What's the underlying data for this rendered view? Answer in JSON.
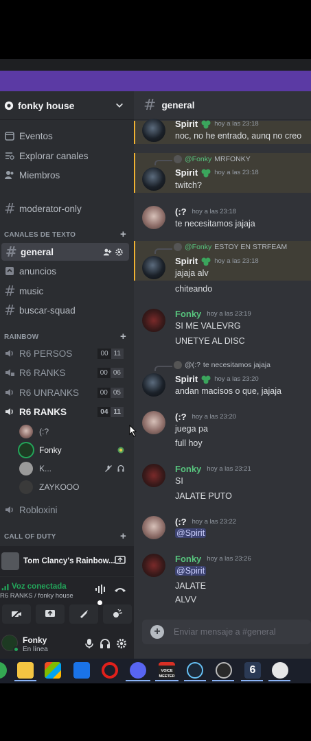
{
  "server": {
    "name": "fonky house"
  },
  "nav": [
    {
      "label": "Eventos",
      "icon": "calendar-icon"
    },
    {
      "label": "Explorar canales",
      "icon": "browse-channels-icon"
    },
    {
      "label": "Miembros",
      "icon": "members-icon"
    }
  ],
  "channels_top": [
    {
      "label": "moderator-only"
    }
  ],
  "categories": {
    "text": "CANALES DE TEXTO",
    "rainbow": "RAINBOW",
    "cod": "CALL OF DUTY"
  },
  "text_channels": [
    {
      "label": "general",
      "active": true
    },
    {
      "label": "anuncios",
      "icon": "announcement-icon"
    },
    {
      "label": "music"
    },
    {
      "label": "buscar-squad"
    }
  ],
  "voice_channels": [
    {
      "label": "R6 PERSOS",
      "a": "00",
      "b": "11"
    },
    {
      "label": "R6 RANKS",
      "a": "00",
      "b": "06"
    },
    {
      "label": "R6 UNRANKS",
      "a": "00",
      "b": "05"
    },
    {
      "label": "R6 RANKS",
      "a": "04",
      "b": "11",
      "bold": true
    }
  ],
  "voice_members": [
    {
      "name": "(:?"
    },
    {
      "name": "Fonky",
      "speaking": true
    },
    {
      "name": "K..."
    },
    {
      "name": "ZAYKOOO"
    }
  ],
  "voice_channels_2": [
    {
      "label": "Robloxini"
    }
  ],
  "activity": {
    "game": "Tom Clancy's Rainbow..."
  },
  "voice_panel": {
    "status": "Voz conectada",
    "sub": "R6 RANKS / fonky house"
  },
  "user": {
    "name": "Fonky",
    "status": "En línea"
  },
  "chat": {
    "channel": "general",
    "input_placeholder": "Enviar mensaje a #general",
    "messages": [
      {
        "author": "Spirit",
        "time": "hoy a las 23:18",
        "lines": [
          "noc, no he entrado, aunq no creo"
        ]
      },
      {
        "reply_to": "@Fonky",
        "reply_text": "MRFONKY",
        "author": "Spirit",
        "time": "hoy a las 23:18",
        "lines": [
          "twitch?"
        ]
      },
      {
        "author": "(:?",
        "time": "hoy a las 23:18",
        "lines": [
          "te necesitamos jajaja"
        ]
      },
      {
        "reply_to": "@Fonky",
        "reply_text": "ESTOY EN STRFEAM",
        "author": "Spirit",
        "time": "hoy a las 23:18",
        "lines": [
          "jajaja alv",
          "chiteando"
        ]
      },
      {
        "author": "Fonky",
        "time": "hoy a las 23:19",
        "lines": [
          "SI  ME VALEVRG",
          "UNETYE AL DISC"
        ]
      },
      {
        "reply_to": "@(:?",
        "reply_text": "te necesitamos jajaja",
        "author": "Spirit",
        "time": "hoy a las 23:20",
        "lines": [
          "andan macisos o que, jajaja"
        ]
      },
      {
        "author": "(:?",
        "time": "hoy a las 23:20",
        "lines": [
          "juega pa",
          "full hoy"
        ]
      },
      {
        "author": "Fonky",
        "time": "hoy a las 23:21",
        "lines": [
          "SI",
          "JALATE PUTO"
        ]
      },
      {
        "author": "(:?",
        "time": "hoy a las 23:22",
        "lines": [
          "@Spirit"
        ]
      },
      {
        "author": "Fonky",
        "time": "hoy a las 23:26",
        "lines": [
          "@Spirit",
          "JALATE",
          "ALVV"
        ]
      }
    ]
  },
  "taskbar": {
    "voicemeeter_label": "VOICE MEETER",
    "apps": [
      "chrome-icon",
      "file-explorer-icon",
      "store-icon",
      "mail-icon",
      "opera-icon",
      "discord-icon",
      "voicemeeter-icon",
      "steam-icon",
      "obs-icon",
      "rainbow-six-icon",
      "skull-app-icon"
    ]
  },
  "colors": {
    "accent_green": "#23a55a",
    "brand_purple": "#5b3aa4",
    "mention_bg": "#3c4270",
    "highlight_border": "#f0b232"
  }
}
